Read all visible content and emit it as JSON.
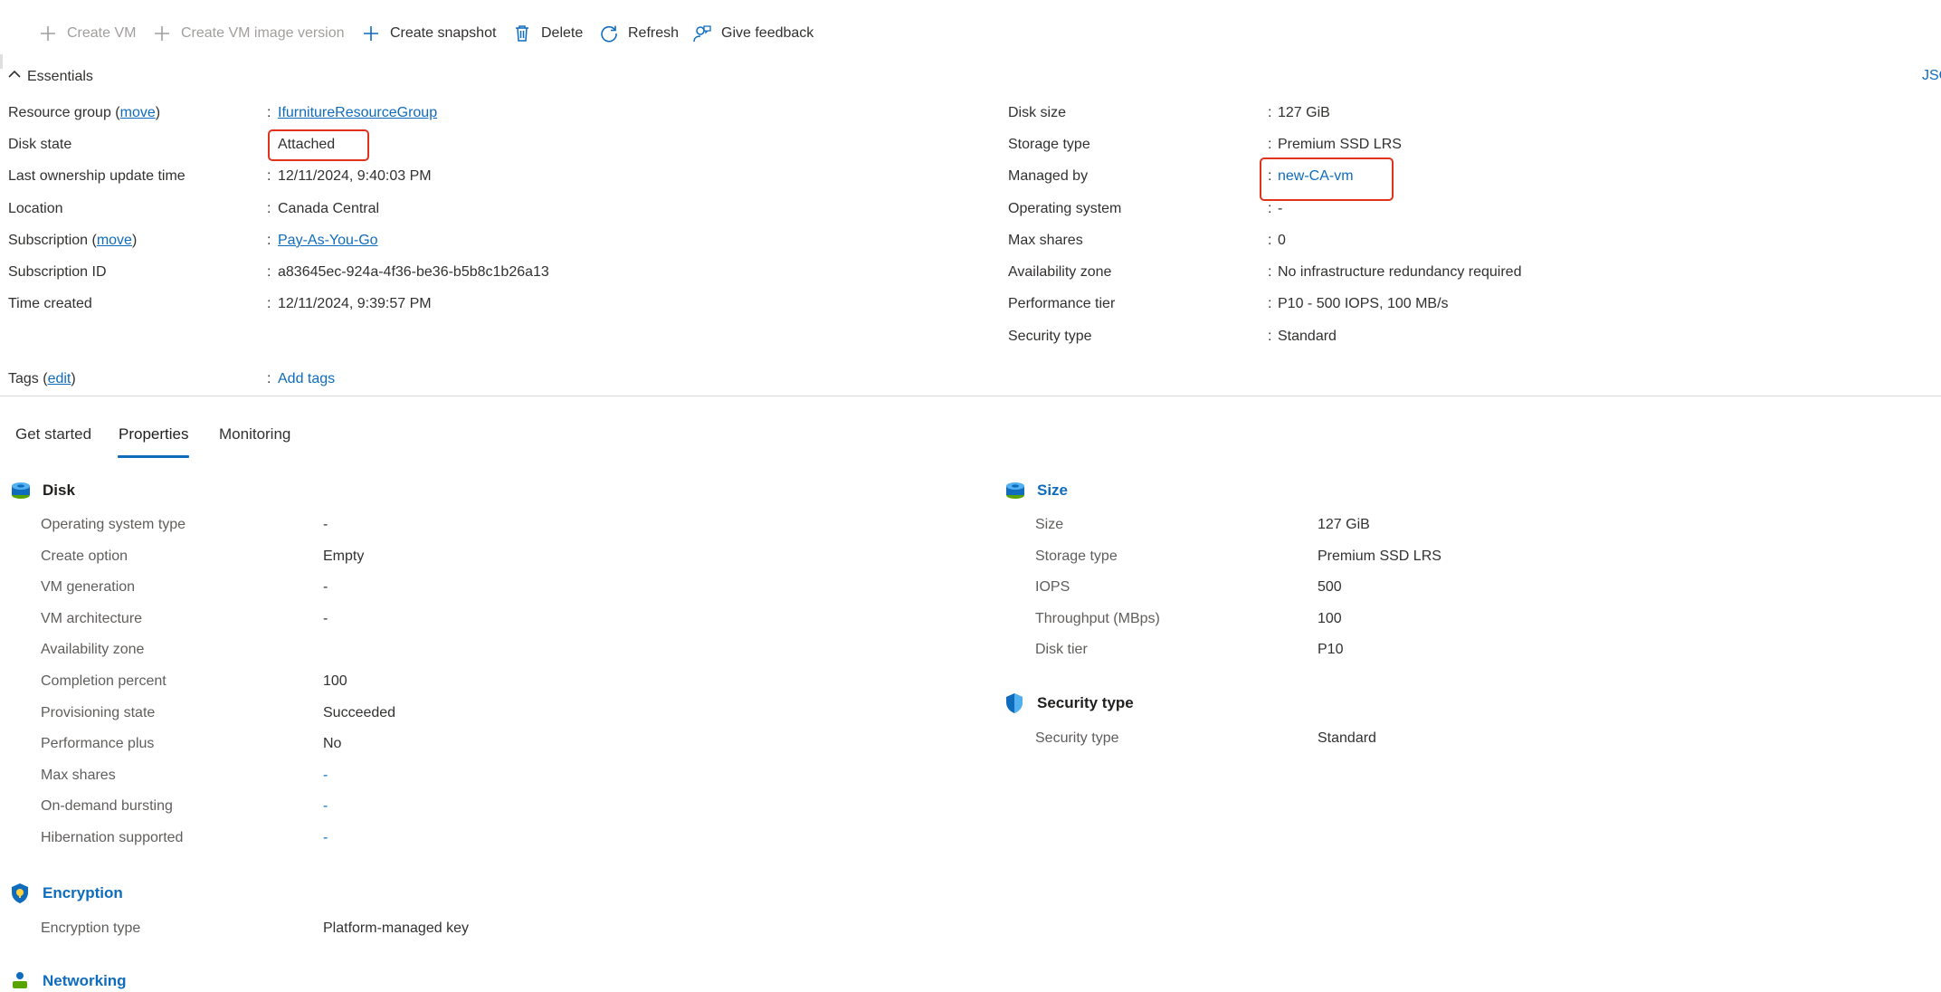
{
  "toolbar": {
    "create_vm": "Create VM",
    "create_vm_image_version": "Create VM image version",
    "create_snapshot": "Create snapshot",
    "delete": "Delete",
    "refresh": "Refresh",
    "give_feedback": "Give feedback"
  },
  "essentials": {
    "header": "Essentials",
    "json_link": "JSO",
    "move_label": "move",
    "edit_label": "edit",
    "left": {
      "resource_group_label": "Resource group (",
      "resource_group_label_end": ")",
      "resource_group_value": "IfurnitureResourceGroup",
      "disk_state_label": "Disk state",
      "disk_state_value": "Attached",
      "last_ownership_label": "Last ownership update time",
      "last_ownership_value": "12/11/2024, 9:40:03 PM",
      "location_label": "Location",
      "location_value": "Canada Central",
      "subscription_label": "Subscription (",
      "subscription_label_end": ")",
      "subscription_value": "Pay-As-You-Go",
      "subscription_id_label": "Subscription ID",
      "subscription_id_value": "a83645ec-924a-4f36-be36-b5b8c1b26a13",
      "time_created_label": "Time created",
      "time_created_value": "12/11/2024, 9:39:57 PM",
      "tags_label": "Tags (",
      "tags_label_end": ")",
      "tags_value": "Add tags"
    },
    "right": {
      "disk_size_label": "Disk size",
      "disk_size_value": "127 GiB",
      "storage_type_label": "Storage type",
      "storage_type_value": "Premium SSD LRS",
      "managed_by_label": "Managed by",
      "managed_by_value": "new-CA-vm",
      "os_label": "Operating system",
      "os_value": "-",
      "max_shares_label": "Max shares",
      "max_shares_value": "0",
      "availability_zone_label": "Availability zone",
      "availability_zone_value": "No infrastructure redundancy required",
      "performance_tier_label": "Performance tier",
      "performance_tier_value": "P10 - 500 IOPS, 100 MB/s",
      "security_type_label": "Security type",
      "security_type_value": "Standard"
    }
  },
  "tabs": {
    "get_started": "Get started",
    "properties": "Properties",
    "monitoring": "Monitoring"
  },
  "properties": {
    "disk": {
      "title": "Disk",
      "rows": [
        {
          "label": "Operating system type",
          "value": "-"
        },
        {
          "label": "Create option",
          "value": "Empty"
        },
        {
          "label": "VM generation",
          "value": "-"
        },
        {
          "label": "VM architecture",
          "value": "-"
        },
        {
          "label": "Availability zone",
          "value": ""
        },
        {
          "label": "Completion percent",
          "value": "100"
        },
        {
          "label": "Provisioning state",
          "value": "Succeeded"
        },
        {
          "label": "Performance plus",
          "value": "No"
        },
        {
          "label": "Max shares",
          "value": "-"
        },
        {
          "label": "On-demand bursting",
          "value": "-"
        },
        {
          "label": "Hibernation supported",
          "value": "-"
        }
      ]
    },
    "encryption": {
      "title": "Encryption",
      "rows": [
        {
          "label": "Encryption type",
          "value": "Platform-managed key"
        }
      ]
    },
    "networking": {
      "title": "Networking"
    },
    "size": {
      "title": "Size",
      "rows": [
        {
          "label": "Size",
          "value": "127 GiB"
        },
        {
          "label": "Storage type",
          "value": "Premium SSD LRS"
        },
        {
          "label": "IOPS",
          "value": "500"
        },
        {
          "label": "Throughput (MBps)",
          "value": "100"
        },
        {
          "label": "Disk tier",
          "value": "P10"
        }
      ]
    },
    "security": {
      "title": "Security type",
      "rows": [
        {
          "label": "Security type",
          "value": "Standard"
        }
      ]
    }
  },
  "colors": {
    "accent": "#0f6cbd",
    "highlight_box": "#e0331a"
  }
}
